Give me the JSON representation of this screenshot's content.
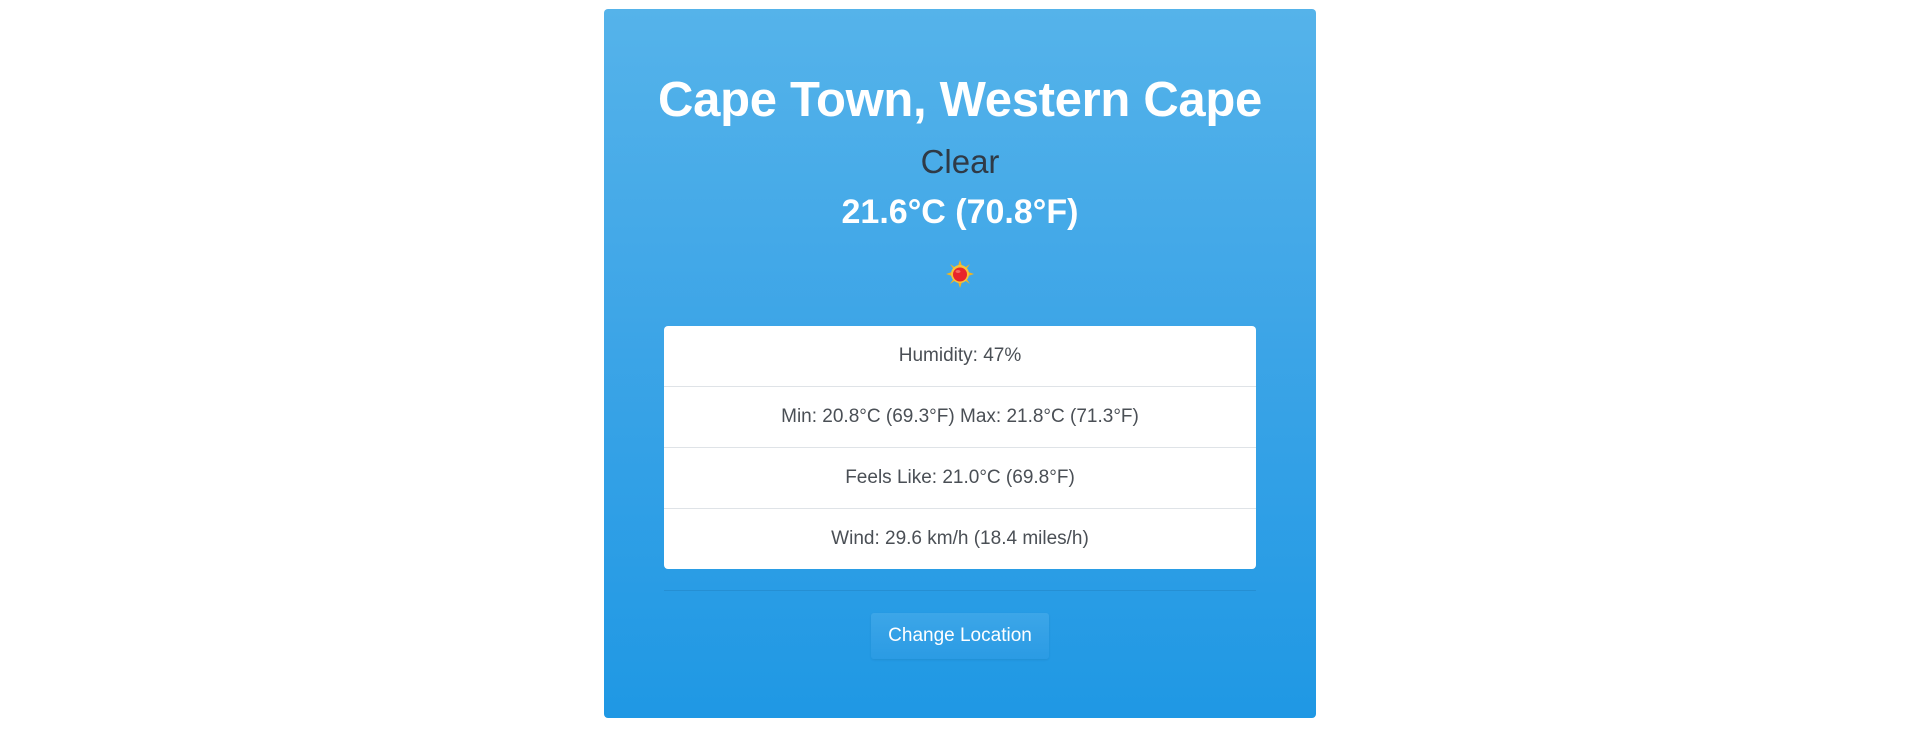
{
  "location": {
    "title": "Cape Town, Western Cape"
  },
  "weather": {
    "condition": "Clear",
    "temperature": "21.6°C (70.8°F)",
    "icon": "sun-icon"
  },
  "details": [
    {
      "text": "Humidity: 47%"
    },
    {
      "text": "Min: 20.8°C (69.3°F) Max: 21.8°C (71.3°F)"
    },
    {
      "text": "Feels Like: 21.0°C (69.8°F)"
    },
    {
      "text": "Wind: 29.6 km/h (18.4 miles/h)"
    }
  ],
  "actions": {
    "change_location_label": "Change Location"
  },
  "colors": {
    "card_top": "#55b3ea",
    "card_bottom": "#1f98e4",
    "condition_text": "#2f3a46",
    "sun_core": "#e8262b",
    "sun_rays": "#f5b41c"
  }
}
